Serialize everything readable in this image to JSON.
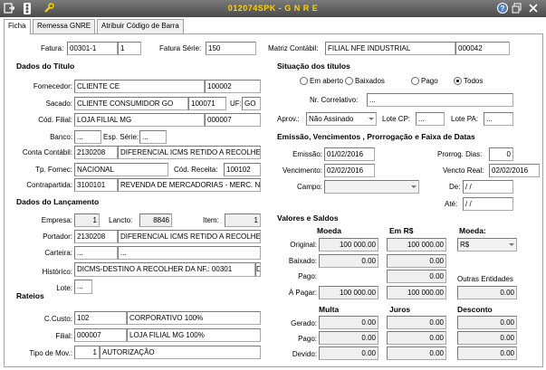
{
  "window": {
    "title": "012074SPK - G N R E"
  },
  "tabs": [
    "Ficha",
    "Remessa GNRE",
    "Atribuir Código de Barra"
  ],
  "top": {
    "fatura_label": "Fatura:",
    "fatura_num": "00301-1",
    "fatura_parc": "1",
    "serie_label": "Fatura Série:",
    "serie": "150",
    "matriz_label": "Matriz Contábil:",
    "matriz_desc": "FILIAL NFE INDUSTRIAL",
    "matriz_code": "000042"
  },
  "titulo": {
    "header": "Dados do Título",
    "fornecedor_label": "Fornecedor:",
    "fornecedor_name": "CLIENTE CE",
    "fornecedor_code": "100002",
    "sacado_label": "Sacado:",
    "sacado_name": "CLIENTE CONSUMIDOR GO",
    "sacado_code": "100071",
    "uf_label": "UF:",
    "uf": "GO",
    "filial_label": "Cód. Filial:",
    "filial_name": "LOJA FILIAL MG",
    "filial_code": "000007",
    "banco_label": "Banco:",
    "banco": "...",
    "esp_label": "Esp. Série:",
    "esp": "...",
    "conta_label": "Conta Contábil:",
    "conta_code": "2130208",
    "conta_desc": "DIFERENCIAL ICMS RETIDO A RECOLHER",
    "tpfornec_label": "Tp. Fornec:",
    "tpfornec": "NACIONAL",
    "receita_label": "Cód. Receita:",
    "receita": "100102",
    "contrapartida_label": "Contrapartida:",
    "contra_code": "3100101",
    "contra_desc": "REVENDA DE MERCADORIAS - MERC. NACIONAL"
  },
  "lancamento": {
    "header": "Dados do Lançamento",
    "empresa_label": "Empresa:",
    "empresa": "1",
    "lancto_label": "Lancto:",
    "lancto": "8846",
    "item_label": "Item:",
    "item": "1",
    "portador_label": "Portador:",
    "portador_code": "2130208",
    "portador_desc": "DIFERENCIAL ICMS RETIDO A RECOLHER",
    "carteira_label": "Carteira:",
    "carteira_a": "...",
    "carteira_b": "...",
    "historico_label": "Histórico:",
    "historico": "DICMS-DESTINO A RECOLHER DA NF.: 00301",
    "historico_b": "D",
    "lote_label": "Lote:",
    "lote": "..."
  },
  "rateios": {
    "header": "Rateios",
    "ccusto_label": "C.Custo:",
    "ccusto_code": "102",
    "ccusto_desc": "CORPORATIVO 100%",
    "filial_label": "Filial:",
    "filial_code": "000007",
    "filial_desc": "LOJA FILIAL MG 100%",
    "tipomov_label": "Tipo de Mov.:",
    "tipomov_code": "1",
    "tipomov_desc": "AUTORIZAÇÃO"
  },
  "situacao": {
    "header": "Situação dos títulos",
    "options": [
      "Em aberto",
      "Baixados",
      "Pago",
      "Todos"
    ],
    "selected": "Todos",
    "correlativo_label": "Nr. Correlativo:",
    "correlativo": "...",
    "aprov_label": "Aprov.:",
    "aprov": "Não Assinado",
    "lotecp_label": "Lote CP:",
    "lotecp": "...",
    "lotepa_label": "Lote PA:",
    "lotepa": "..."
  },
  "emissao": {
    "header": "Emissão, Vencimentos , Prorrogação e Faixa de Datas",
    "emissao_label": "Emissão:",
    "emissao": "01/02/2016",
    "prorrog_label": "Prorrog. Dias:",
    "prorrog": "0",
    "venc_label": "Vencimento:",
    "venc": "02/02/2016",
    "vencreal_label": "Vencto Real:",
    "vencreal": "02/02/2016",
    "campo_label": "Campo:",
    "campo": "",
    "de_label": "De:",
    "de": "/ /",
    "ate_label": "Até:",
    "ate": "/ /"
  },
  "valores": {
    "header": "Valores e Saldos",
    "col_moeda": "Moeda",
    "col_emrs": "Em R$",
    "col_moeda2": "Moeda:",
    "original_label": "Original:",
    "original_moeda": "100 000.00",
    "original_rs": "100 000.00",
    "moeda_sel": "R$",
    "baixado_label": "Baixado:",
    "baixado_moeda": "0.00",
    "baixado_rs": "0.00",
    "pago_label": "Pago:",
    "pago_rs": "0.00",
    "outras_label": "Outras Entidades",
    "apagar_label": "À Pagar:",
    "apagar_moeda": "100 000.00",
    "apagar_rs": "100 000.00",
    "outras": "0.00",
    "col_multa": "Multa",
    "col_juros": "Juros",
    "col_desconto": "Desconto",
    "gerado_label": "Gerado:",
    "gerado_multa": "0.00",
    "gerado_juros": "0.00",
    "gerado_desc": "0.00",
    "pago2_label": "Pago:",
    "pago_multa": "0.00",
    "pago_juros": "0.00",
    "pago_desc": "0.00",
    "devido_label": "Devido:",
    "devido_multa": "0.00",
    "devido_juros": "0.00",
    "devido_desc": "0.00"
  }
}
